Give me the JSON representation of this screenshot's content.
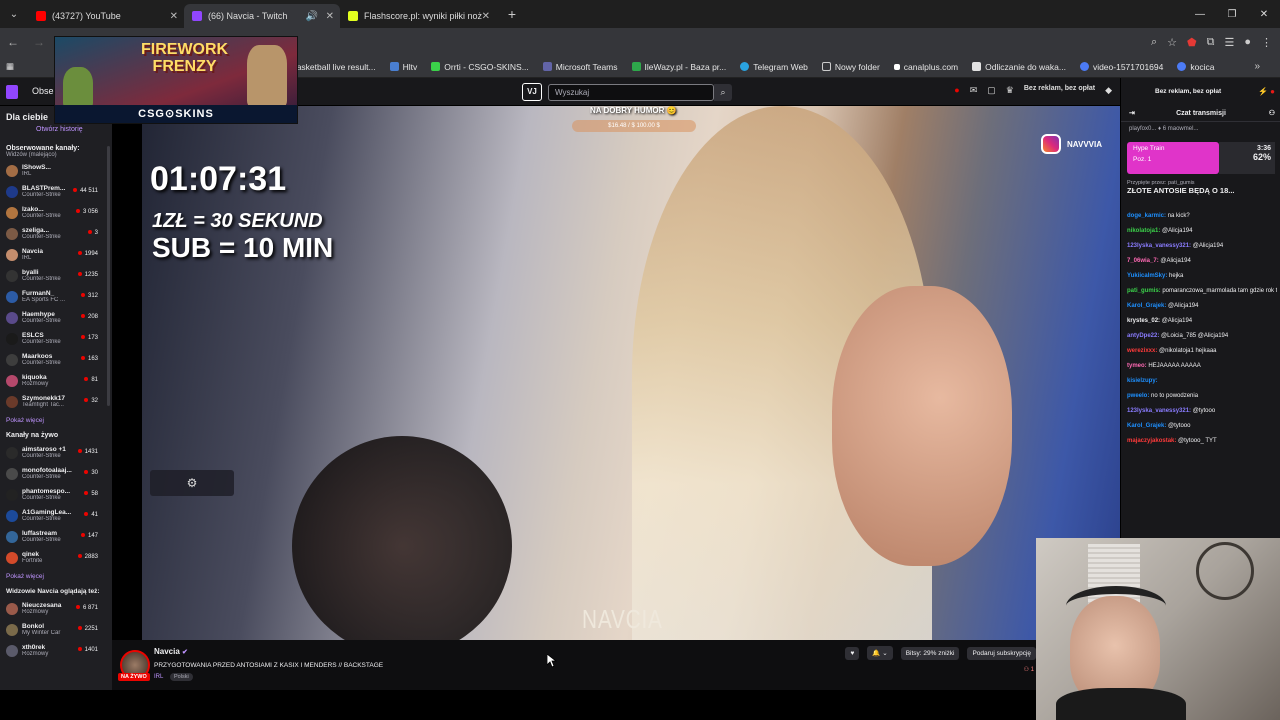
{
  "browser": {
    "tabs": [
      {
        "title": "(43727) YouTube",
        "color": "#ff0000",
        "active": false
      },
      {
        "title": "(66) Navcia - Twitch",
        "color": "#9146ff",
        "active": true
      },
      {
        "title": "Flashscore.pl: wyniki piłki nożne",
        "color": "#e2ff1f",
        "active": false
      }
    ],
    "bookmarks": [
      {
        "label": "Basketball live result...",
        "color": "#3b5bdb"
      },
      {
        "label": "Hltv",
        "color": "#ffffff"
      },
      {
        "label": "Orrti - CSGO-SKINS...",
        "color": "#3bd14a"
      },
      {
        "label": "Microsoft Teams",
        "color": "#6264a7"
      },
      {
        "label": "IleWazy.pl - Baza pr...",
        "color": "#2ea84b"
      },
      {
        "label": "Telegram Web",
        "color": "#2aa3e0"
      },
      {
        "label": "Nowy folder",
        "color": "#d6d6d6"
      },
      {
        "label": "canalplus.com",
        "color": "#ffffff"
      },
      {
        "label": "Odliczanie do waka...",
        "color": "#e2e2e2"
      },
      {
        "label": "video-1571701694",
        "color": "#4c7bf5"
      },
      {
        "label": "kocica",
        "color": "#4c7bf5"
      }
    ]
  },
  "twitch": {
    "browse": "Obser",
    "search_placeholder": "Wyszukaj",
    "vj_logo": "VJ",
    "no_ads": "Bez reklam, bez opłat"
  },
  "sidebar": {
    "for_you": "Dla ciebie",
    "history": "Otwórz historię",
    "followed": "Obserwowane kanały:",
    "followed_sub": "Widzów (malejąco)",
    "channels": [
      {
        "name": "IShowS...",
        "game": "IRL",
        "viewers": "",
        "color": "#a36d45"
      },
      {
        "name": "BLASTPrem...",
        "game": "Counter-Strike",
        "viewers": "44 511",
        "color": "#1e3a8a"
      },
      {
        "name": "Izako...",
        "game": "Counter-Strike",
        "viewers": "3 056",
        "color": "#b2753f"
      },
      {
        "name": "szeliga...",
        "game": "Counter-Strike",
        "viewers": "3",
        "color": "#7c5a45"
      },
      {
        "name": "Navcia",
        "game": "IRL",
        "viewers": "1994",
        "color": "#c48d6d"
      },
      {
        "name": "byalli",
        "game": "Counter-Strike",
        "viewers": "1235",
        "color": "#333333"
      },
      {
        "name": "FurmanN_",
        "game": "EA Sports FC ...",
        "viewers": "312",
        "color": "#2c5ba5"
      },
      {
        "name": "Haemhype",
        "game": "Counter-Strike",
        "viewers": "208",
        "color": "#5a4a8a"
      },
      {
        "name": "ESLCS",
        "game": "Counter-Strike",
        "viewers": "173",
        "color": "#1a1a1a"
      },
      {
        "name": "Maarkoos",
        "game": "Counter-Strike",
        "viewers": "163",
        "color": "#3d3d3d"
      },
      {
        "name": "kiquoka",
        "game": "Rozmowy",
        "viewers": "81",
        "color": "#b5486b"
      },
      {
        "name": "Szymonekk17",
        "game": "Teamfight Tac...",
        "viewers": "32",
        "color": "#6a3a2a"
      }
    ],
    "show_more": "Pokaż więcej",
    "live_section": "Kanały na żywo",
    "live_channels": [
      {
        "name": "aimstaroso +1",
        "game": "Counter-Strike",
        "viewers": "1431",
        "color": "#2a2a2a"
      },
      {
        "name": "monofotoalaaj...",
        "game": "Counter-Strike",
        "viewers": "30",
        "color": "#4a4a4a"
      },
      {
        "name": "phantomespo...",
        "game": "Counter-Strike",
        "viewers": "58",
        "color": "#222222"
      },
      {
        "name": "A1GamingLea...",
        "game": "Counter-Strike",
        "viewers": "41",
        "color": "#1c4a9a"
      },
      {
        "name": "luffastream",
        "game": "Counter-Strike",
        "viewers": "147",
        "color": "#336699"
      },
      {
        "name": "qinek",
        "game": "Fortnite",
        "viewers": "2883",
        "color": "#d34a2a"
      }
    ],
    "show_more2": "Pokaż więcej",
    "also_watch": "Widzowie Navcia oglądają też:",
    "also_channels": [
      {
        "name": "Nieuczesana",
        "game": "Rozmowy",
        "viewers": "6 871",
        "color": "#9a5a4a"
      },
      {
        "name": "Bonkol",
        "game": "My Winter Car",
        "viewers": "2251",
        "color": "#7a6a4a"
      },
      {
        "name": "xth0rek",
        "game": "Rozmowy",
        "viewers": "1401",
        "color": "#5a5a6a"
      }
    ]
  },
  "ad": {
    "title_line1": "FIREWORK",
    "title_line2": "FRENZY",
    "brand": "CSG⊙SKINS"
  },
  "overlay": {
    "timer": "01:07:31",
    "line1": "1ZŁ = 30 SEKUND",
    "line2": "SUB = 10 MIN",
    "mood": "NA DOBRY HUMOR 😊",
    "goal": "$16.48 / $  100.00 $",
    "instagram": "NAVVVIA",
    "watermark": "NAVCIA"
  },
  "chat": {
    "title": "Czat transmisji",
    "pinned_by": "playfox0... ♦ 6   maowmel...",
    "hype_title": "Hype Train",
    "hype_level": "Poz. 1",
    "hype_time": "3:36",
    "hype_pct": "62%",
    "hype_progress": 0.62,
    "pinned_note": "Przypięte przez: pati_gumis",
    "pinned_msg": "ZŁOTE ANTOSIE BĘDĄ O 18...",
    "messages": [
      {
        "user": "doge_karmic:",
        "text": " na kick?",
        "color": "#1e90ff"
      },
      {
        "user": "nikolatoja1:",
        "text": " @Alicja194",
        "color": "#3bd14a"
      },
      {
        "user": "123lyska_vanessy321:",
        "text": " @Alicja194",
        "color": "#8a7cff"
      },
      {
        "user": "7_06wia_7:",
        "text": " @Alicja194",
        "color": "#ff69b4"
      },
      {
        "user": "YukiicalmSky:",
        "text": " hejka",
        "color": "#1e90ff"
      },
      {
        "user": "pati_gumis:",
        "text": " pomaranczowa_marmolada tam gdzie rok temu",
        "color": "#3bd14a"
      },
      {
        "user": "Karol_Grajek:",
        "text": " @Alicja194",
        "color": "#1e90ff"
      },
      {
        "user": "krystes_02:",
        "text": " @Alicja194",
        "color": "#efeff1"
      },
      {
        "user": "antyDpe22:",
        "text": " @Loicia_785 @Alicja194",
        "color": "#8a7cff"
      },
      {
        "user": "werezixxx:",
        "text": " @nikolatoja1 hejkaaa",
        "color": "#ff3a3a"
      },
      {
        "user": "tymeo:",
        "text": " HEJAAAAA AAAAA",
        "color": "#ff69b4"
      },
      {
        "user": "kisielzupy:",
        "text": "",
        "color": "#1e90ff"
      },
      {
        "user": "pweelo:",
        "text": " no to powodzenia",
        "color": "#1e90ff"
      },
      {
        "user": "123lyska_vanessy321:",
        "text": " @tytooo",
        "color": "#8a7cff"
      },
      {
        "user": "Karol_Grajek:",
        "text": " @tytooo",
        "color": "#1e90ff"
      },
      {
        "user": "majaczyjakostak:",
        "text": " @tytooo_ TYT",
        "color": "#ff3a3a"
      }
    ]
  },
  "stream_info": {
    "streamer": "Navcia",
    "title": "PRZYGOTOWANIA PRZED ANTOSIAMI Z KASIX I MENDERS // BACKSTAGE",
    "live_badge": "NA ŻYWO",
    "category": "IRL",
    "tag": "Polski",
    "bits": "Bitsy: 29% zniżki",
    "subscribe": "Podaruj subskrypcję",
    "viewers": "1"
  }
}
